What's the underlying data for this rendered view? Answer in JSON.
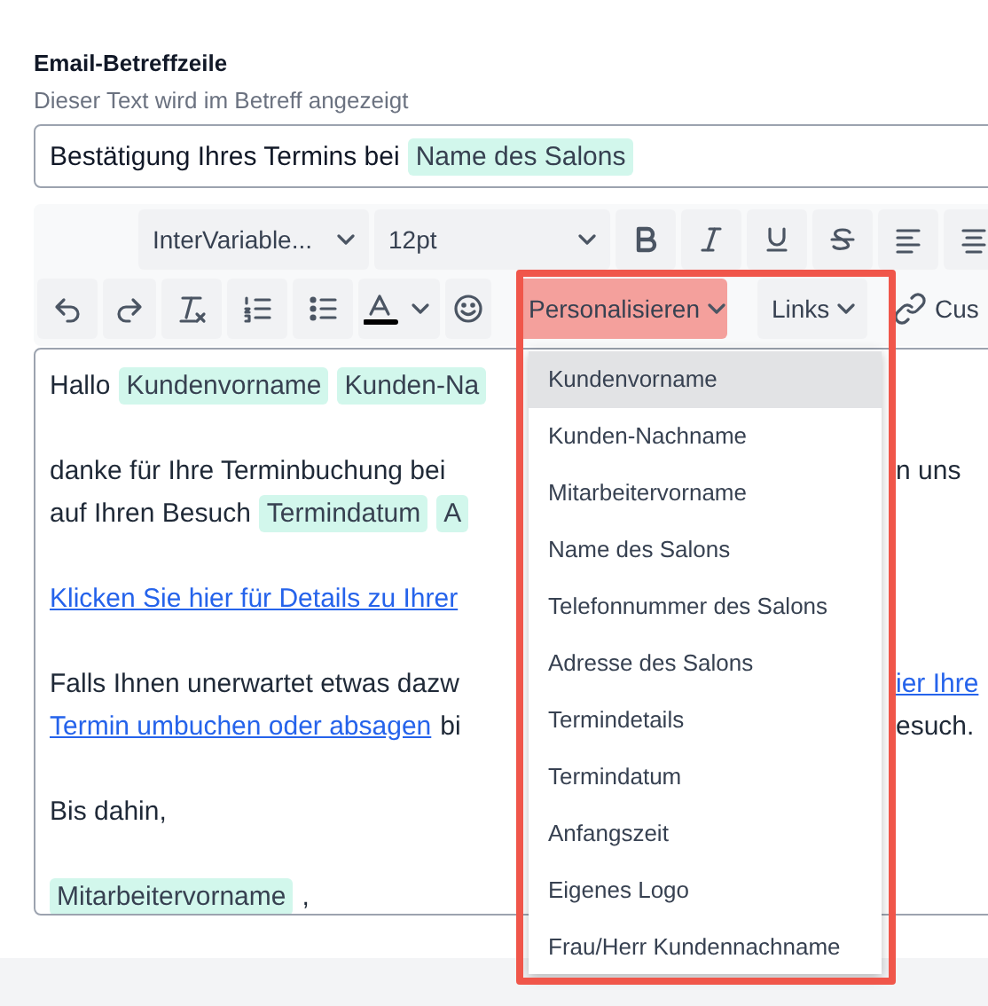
{
  "subject_field": {
    "label": "Email-Betreffzeile",
    "hint": "Dieser Text wird im Betreff angezeigt",
    "value": [
      {
        "kind": "text",
        "text": "Bestätigung Ihres Termins bei"
      },
      {
        "kind": "tag",
        "text": "Name des Salons"
      }
    ]
  },
  "toolbar": {
    "font_select": "InterVariable...",
    "size_select": "12pt",
    "personalize_button": {
      "label": "Personalisieren",
      "highlighted": true
    },
    "links_button": "Links",
    "custom_button": "Cus"
  },
  "editor": {
    "paragraphs": [
      {
        "lines": [
          {
            "left": [
              {
                "kind": "text",
                "text": "Hallo"
              },
              {
                "kind": "tag",
                "text": "Kundenvorname"
              },
              {
                "kind": "tag",
                "text": "Kunden-Na"
              }
            ]
          }
        ]
      },
      {
        "lines": [
          {
            "left": [
              {
                "kind": "text",
                "text": "danke für Ihre Terminbuchung bei"
              }
            ],
            "right": [
              {
                "kind": "text",
                "text": "n uns"
              }
            ]
          },
          {
            "left": [
              {
                "kind": "text",
                "text": "auf Ihren Besuch"
              },
              {
                "kind": "tag",
                "text": "Termindatum"
              },
              {
                "kind": "tag",
                "text": "A"
              }
            ]
          }
        ]
      },
      {
        "lines": [
          {
            "left": [
              {
                "kind": "link",
                "text": "Klicken Sie hier für Details zu Ihrer"
              }
            ]
          }
        ]
      },
      {
        "lines": [
          {
            "left": [
              {
                "kind": "text",
                "text": "Falls Ihnen unerwartet etwas dazw"
              }
            ],
            "right": [
              {
                "kind": "link",
                "text": "ier Ihre"
              }
            ]
          },
          {
            "left": [
              {
                "kind": "link",
                "text": "Termin umbuchen oder absagen"
              },
              {
                "kind": "text",
                "text": "bi"
              }
            ],
            "right": [
              {
                "kind": "text",
                "text": "esuch."
              }
            ]
          }
        ]
      },
      {
        "lines": [
          {
            "left": [
              {
                "kind": "text",
                "text": "Bis dahin,"
              }
            ]
          }
        ]
      },
      {
        "lines": [
          {
            "left": [
              {
                "kind": "tag",
                "text": "Mitarbeitervorname"
              },
              {
                "kind": "text",
                "text": ","
              }
            ]
          }
        ]
      }
    ]
  },
  "personalize_menu": {
    "items": [
      {
        "label": "Kundenvorname",
        "selected": true
      },
      {
        "label": "Kunden-Nachname",
        "selected": false
      },
      {
        "label": "Mitarbeitervorname",
        "selected": false
      },
      {
        "label": "Name des Salons",
        "selected": false
      },
      {
        "label": "Telefonnummer des Salons",
        "selected": false
      },
      {
        "label": "Adresse des Salons",
        "selected": false
      },
      {
        "label": "Termindetails",
        "selected": false
      },
      {
        "label": "Termindatum",
        "selected": false
      },
      {
        "label": "Anfangszeit",
        "selected": false
      },
      {
        "label": "Eigenes Logo",
        "selected": false
      },
      {
        "label": "Frau/Herr Kundennachname",
        "selected": false
      }
    ]
  }
}
